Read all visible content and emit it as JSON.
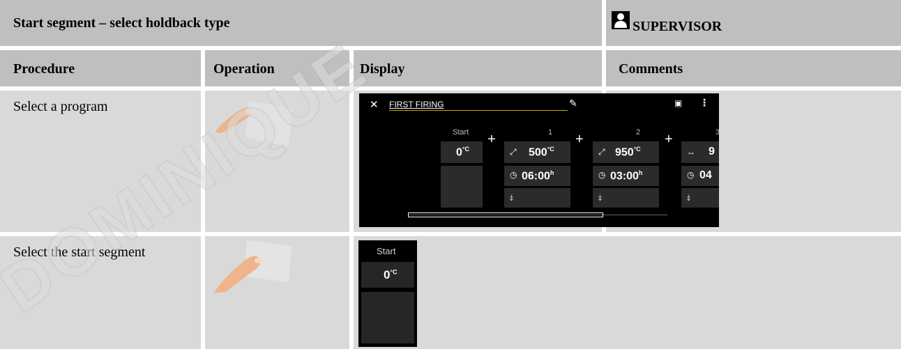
{
  "header": {
    "title": "Start segment – select holdback type",
    "role": "SUPERVISOR",
    "role_icon": "user-icon"
  },
  "columns": [
    "Procedure",
    "Operation",
    "Display",
    "Comments"
  ],
  "rows": [
    {
      "procedure": "Select a program",
      "operation_icon": "finger-touch-icon"
    },
    {
      "procedure": "Select the start segment",
      "operation_icon": "finger-touch-icon"
    }
  ],
  "display1": {
    "program_name": "FIRST FIRING",
    "start_label": "Start",
    "start_temp": "0",
    "temp_unit": "°C",
    "time_unit": "h",
    "segments": [
      {
        "label": "1",
        "temp": "500",
        "time": "06:00",
        "ramp_icon": "ramp-up-icon"
      },
      {
        "label": "2",
        "temp": "950",
        "time": "03:00",
        "ramp_icon": "ramp-up-icon"
      },
      {
        "label": "3",
        "temp": "9",
        "time": "04",
        "ramp_icon": "hold-icon"
      }
    ],
    "icons": [
      "close-icon",
      "edit-icon",
      "save-icon",
      "more-icon",
      "clock-icon",
      "add-event-icon"
    ]
  },
  "display2": {
    "start_label": "Start",
    "start_temp": "0",
    "temp_unit": "°C"
  },
  "watermark": "DOMINIQUE"
}
